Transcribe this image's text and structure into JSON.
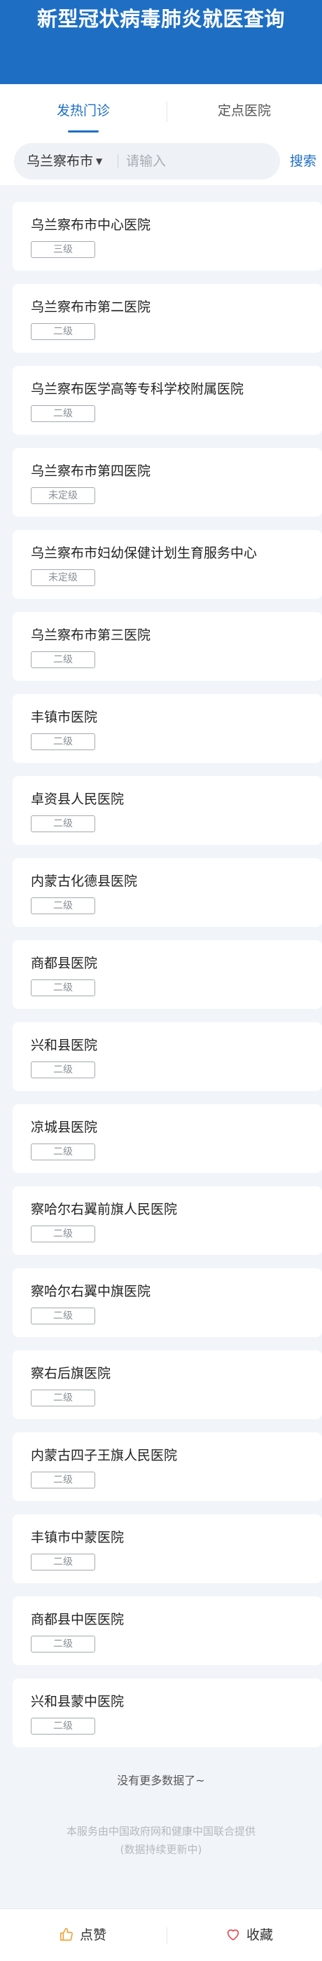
{
  "header": {
    "title": "新型冠状病毒肺炎就医查询"
  },
  "tabs": [
    {
      "label": "发热门诊",
      "active": true
    },
    {
      "label": "定点医院",
      "active": false
    }
  ],
  "search": {
    "city": "乌兰察布市",
    "placeholder": "请输入",
    "value": "",
    "button": "搜索"
  },
  "hospitals": [
    {
      "name": "乌兰察布市中心医院",
      "level": "三级"
    },
    {
      "name": "乌兰察布市第二医院",
      "level": "二级"
    },
    {
      "name": "乌兰察布医学高等专科学校附属医院",
      "level": "二级"
    },
    {
      "name": "乌兰察布市第四医院",
      "level": "未定级"
    },
    {
      "name": "乌兰察布市妇幼保健计划生育服务中心",
      "level": "未定级"
    },
    {
      "name": "乌兰察布市第三医院",
      "level": "二级"
    },
    {
      "name": "丰镇市医院",
      "level": "二级"
    },
    {
      "name": "卓资县人民医院",
      "level": "二级"
    },
    {
      "name": "内蒙古化德县医院",
      "level": "二级"
    },
    {
      "name": "商都县医院",
      "level": "二级"
    },
    {
      "name": "兴和县医院",
      "level": "二级"
    },
    {
      "name": "凉城县医院",
      "level": "二级"
    },
    {
      "name": "察哈尔右翼前旗人民医院",
      "level": "二级"
    },
    {
      "name": "察哈尔右翼中旗医院",
      "level": "二级"
    },
    {
      "name": "察右后旗医院",
      "level": "二级"
    },
    {
      "name": "内蒙古四子王旗人民医院",
      "level": "二级"
    },
    {
      "name": "丰镇市中蒙医院",
      "level": "二级"
    },
    {
      "name": "商都县中医医院",
      "level": "二级"
    },
    {
      "name": "兴和县蒙中医院",
      "level": "二级"
    }
  ],
  "list_end": "没有更多数据了~",
  "footer": {
    "line1": "本服务由中国政府网和健康中国联合提供",
    "line2": "(数据持续更新中)"
  },
  "bottom_bar": {
    "like_label": "点赞",
    "like_icon": "thumbs-up-icon",
    "favorite_label": "收藏",
    "favorite_icon": "heart-icon"
  },
  "colors": {
    "brand_blue": "#1e6fc4",
    "page_bg": "#f1f5f9",
    "like_icon": "#f2a33a",
    "favorite_icon": "#e5484d"
  }
}
